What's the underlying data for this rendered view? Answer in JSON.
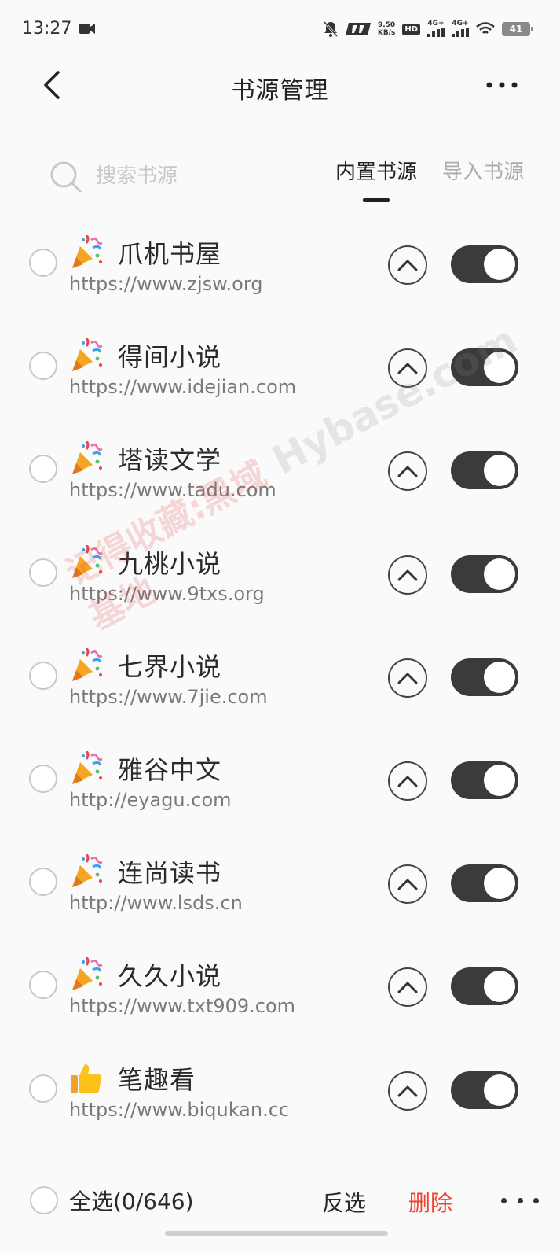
{
  "status_bar": {
    "time": "13:27",
    "net_speed_value": "9.50",
    "net_speed_unit": "KB/s",
    "hd_label": "HD",
    "signal_1": "4G+",
    "signal_2": "4G+",
    "battery": "41"
  },
  "header": {
    "title": "书源管理",
    "back_icon": "chevron-left-icon",
    "more_icon": "more-horizontal-icon"
  },
  "search": {
    "placeholder": "搜索书源",
    "icon": "search-icon"
  },
  "tabs": [
    {
      "label": "内置书源",
      "active": true
    },
    {
      "label": "导入书源",
      "active": false
    }
  ],
  "sources": [
    {
      "icon": "party-popper-icon",
      "name": "爪机书屋",
      "url": "https://www.zjsw.org",
      "enabled": true,
      "selected": false
    },
    {
      "icon": "party-popper-icon",
      "name": "得间小说",
      "url": "https://www.idejian.com",
      "enabled": true,
      "selected": false
    },
    {
      "icon": "party-popper-icon",
      "name": "塔读文学",
      "url": "https://www.tadu.com",
      "enabled": true,
      "selected": false
    },
    {
      "icon": "party-popper-icon",
      "name": "九桃小说",
      "url": "https://www.9txs.org",
      "enabled": true,
      "selected": false
    },
    {
      "icon": "party-popper-icon",
      "name": "七界小说",
      "url": "https://www.7jie.com",
      "enabled": true,
      "selected": false
    },
    {
      "icon": "party-popper-icon",
      "name": "雅谷中文",
      "url": "http://eyagu.com",
      "enabled": true,
      "selected": false
    },
    {
      "icon": "party-popper-icon",
      "name": "连尚读书",
      "url": "http://www.lsds.cn",
      "enabled": true,
      "selected": false
    },
    {
      "icon": "party-popper-icon",
      "name": "久久小说",
      "url": "https://www.txt909.com",
      "enabled": true,
      "selected": false
    },
    {
      "icon": "thumbs-up-icon",
      "name": "笔趣看",
      "url": "https://www.biqukan.cc",
      "enabled": true,
      "selected": false
    }
  ],
  "watermark": {
    "text_cn": "记得收藏:黑域基地",
    "text_en": "Hybase.com"
  },
  "bottom_bar": {
    "select_all_label": "全选(0/646)",
    "invert_label": "反选",
    "delete_label": "删除",
    "delete_color": "#ee4433",
    "more_icon": "more-horizontal-icon"
  },
  "colors": {
    "toggle_on": "#3b3b3b",
    "background": "#fafafa",
    "accent_delete": "#ee4433"
  }
}
